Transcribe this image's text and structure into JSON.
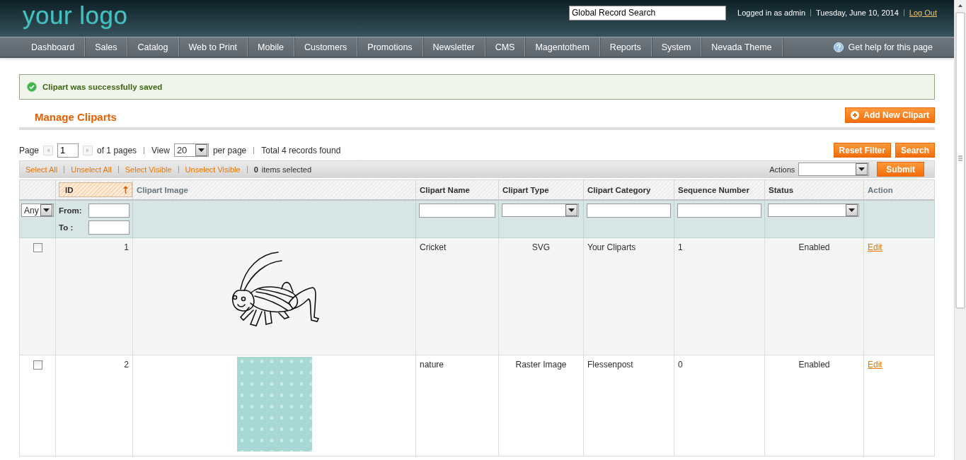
{
  "header": {
    "logo": "your logo",
    "search": {
      "value": "Global Record Search"
    },
    "user": "Logged in as admin",
    "date": "Tuesday, June 10, 2014",
    "logout": "Log Out"
  },
  "nav": {
    "items": [
      {
        "label": "Dashboard"
      },
      {
        "label": "Sales"
      },
      {
        "label": "Catalog"
      },
      {
        "label": "Web to Print"
      },
      {
        "label": "Mobile"
      },
      {
        "label": "Customers"
      },
      {
        "label": "Promotions"
      },
      {
        "label": "Newsletter"
      },
      {
        "label": "CMS"
      },
      {
        "label": "Magentothem"
      },
      {
        "label": "Reports"
      },
      {
        "label": "System"
      },
      {
        "label": "Nevada Theme"
      }
    ],
    "help": "Get help for this page"
  },
  "message": {
    "kind": "success",
    "text": "Clipart was successfully saved"
  },
  "page_title": "Manage Cliparts",
  "add_button": "Add New Clipart",
  "pager": {
    "page_label": "Page",
    "page": "1",
    "of_pages": "of 1 pages",
    "view_label": "View",
    "per_page": "20",
    "per_page_label": "per page",
    "total": "Total 4 records found"
  },
  "grid_buttons": [
    "Reset Filter",
    "Search"
  ],
  "massaction": {
    "links": [
      "Select All",
      "Unselect All",
      "Select Visible",
      "Unselect Visible"
    ],
    "count": "0",
    "count_label": "items selected",
    "actions_label": "Actions",
    "submit": "Submit"
  },
  "table": {
    "columns": [
      {
        "label": "ID",
        "sortable": true,
        "sorted": true
      },
      {
        "label": "Clipart Image",
        "sortable": false,
        "sorted": false
      },
      {
        "label": "Clipart Name",
        "sortable": true,
        "sorted": false
      },
      {
        "label": "Clipart Type",
        "sortable": true,
        "sorted": false
      },
      {
        "label": "Clipart Category",
        "sortable": true,
        "sorted": false
      },
      {
        "label": "Sequence Number",
        "sortable": true,
        "sorted": false
      },
      {
        "label": "Status",
        "sortable": true,
        "sorted": false
      },
      {
        "label": "Action",
        "sortable": false,
        "sorted": false
      }
    ],
    "filter": {
      "any": "Any",
      "from": "From:",
      "to": "To :"
    },
    "rows": [
      {
        "checked": false,
        "id": "1",
        "kind": "drawing",
        "name": "Cricket",
        "type": "SVG",
        "category": "Your Cliparts",
        "sequence": "1",
        "status": "Enabled",
        "action": "Edit"
      },
      {
        "checked": false,
        "id": "2",
        "kind": "photo",
        "name": "nature",
        "type": "Raster Image",
        "category": "Flessenpost",
        "sequence": "0",
        "status": "Enabled",
        "action": "Edit"
      }
    ]
  }
}
